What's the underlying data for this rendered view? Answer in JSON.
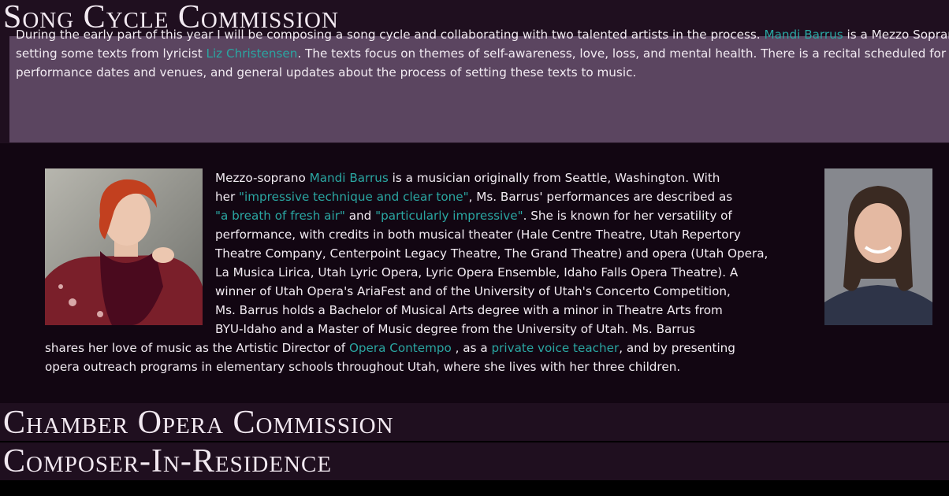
{
  "song_cycle": {
    "title": "Song Cycle Commission",
    "intro": {
      "l1_a": "During the early part of this year I will be composing a song cycle and collaborating with two talented artists in the process. ",
      "l1_link": "Mandi Barrus",
      "l1_b": " is a Mezzo Soprano th",
      "l2_a": "setting some texts from lyricist ",
      "l2_link": "Liz Christensen",
      "l2_b": ". The texts focus on themes of self-awareness, love, loss, and mental health. There is a recital scheduled for the fall",
      "l3": "performance dates and venues, and general updates about the process of setting these texts to music."
    }
  },
  "bio": {
    "l1_a": "Mezzo-soprano ",
    "l1_link": "Mandi Barrus",
    "l1_b": " is a musician originally from Seattle, Washington. With",
    "l2_a": "her ",
    "l2_link": "\"impressive technique and clear tone\"",
    "l2_b": ", Ms. Barrus' performances are described as",
    "l3_link1": "\"a breath of fresh air\"",
    "l3_mid": " and ",
    "l3_link2": "\"particularly impressive\"",
    "l3_b": ". She is known for her versatility of",
    "l4": "performance, with credits in both musical theater (Hale Centre Theatre, Utah Repertory",
    "l5": "Theatre Company, Centerpoint Legacy Theatre, The Grand Theatre) and opera (Utah Opera,",
    "l6": "La Musica Lirica, Utah Lyric Opera, Lyric Opera Ensemble, Idaho Falls Opera Theatre). A",
    "l7": "winner of Utah Opera's AriaFest and of the University of Utah's Concerto Competition,",
    "l8": "Ms. Barrus holds a Bachelor of Musical Arts degree with a minor in Theatre Arts from",
    "l9": "BYU-Idaho and a Master of Music degree from the University of Utah. Ms. Barrus",
    "l10_a": "shares her love of music as the Artistic Director of ",
    "l10_link1": "Opera Contempo",
    "l10_mid": " , as a ",
    "l10_link2": "private voice teacher",
    "l10_b": ", and by presenting",
    "l11": "opera outreach programs in elementary schools throughout Utah, where she lives with her three children."
  },
  "chamber_opera": {
    "title": "Chamber Opera Commission"
  },
  "composer_residence": {
    "title": "Composer-In-Residence"
  },
  "colors": {
    "header_bg": "#1f0f1f",
    "intro_bg": "#5b4560",
    "link": "#2aa6a2",
    "bio_bg": "#120612"
  }
}
